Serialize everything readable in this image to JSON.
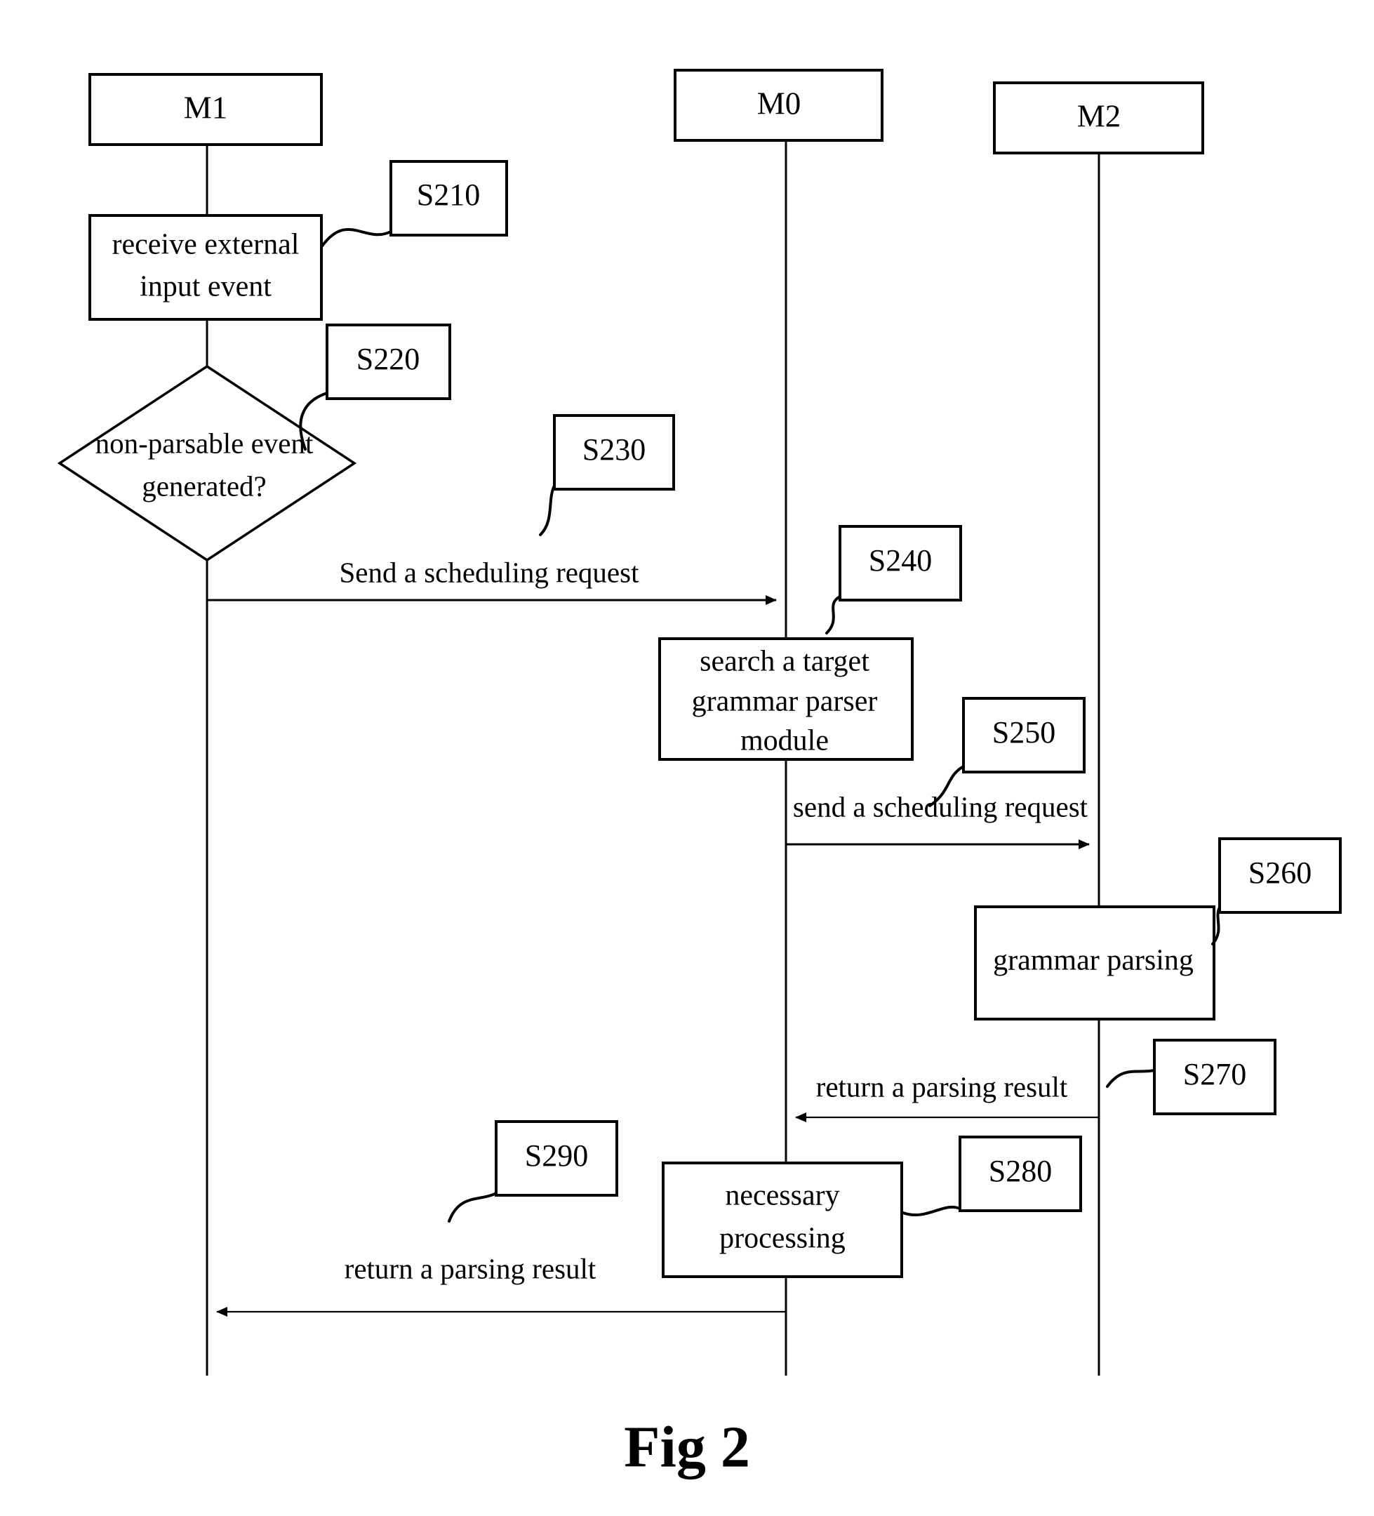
{
  "figure": {
    "caption": "Fig 2",
    "type": "sequence-flow-diagram"
  },
  "lifelines": [
    {
      "id": "m1",
      "label": "M1"
    },
    {
      "id": "m0",
      "label": "M0"
    },
    {
      "id": "m2",
      "label": "M2"
    }
  ],
  "activities": {
    "receive_event": {
      "line1": "receive external",
      "line2": "input event"
    },
    "search_parser": {
      "line1": "search a target",
      "line2": "grammar parser",
      "line3": "module"
    },
    "grammar_parsing": {
      "line1": "grammar parsing"
    },
    "necessary_processing": {
      "line1": "necessary",
      "line2": "processing"
    }
  },
  "decision": {
    "line1": "non-parsable event",
    "line2": "generated?"
  },
  "messages": {
    "send_request_m1_m0": "Send a scheduling request",
    "send_request_m0_m2": "send a scheduling request",
    "return_result_m2_m0": "return a parsing result",
    "return_result_m0_m1": "return a parsing result"
  },
  "step_refs": {
    "s210": "S210",
    "s220": "S220",
    "s230": "S230",
    "s240": "S240",
    "s250": "S250",
    "s260": "S260",
    "s270": "S270",
    "s280": "S280",
    "s290": "S290"
  },
  "colors": {
    "stroke": "#000000",
    "fill": "#ffffff",
    "background": "#ffffff"
  }
}
